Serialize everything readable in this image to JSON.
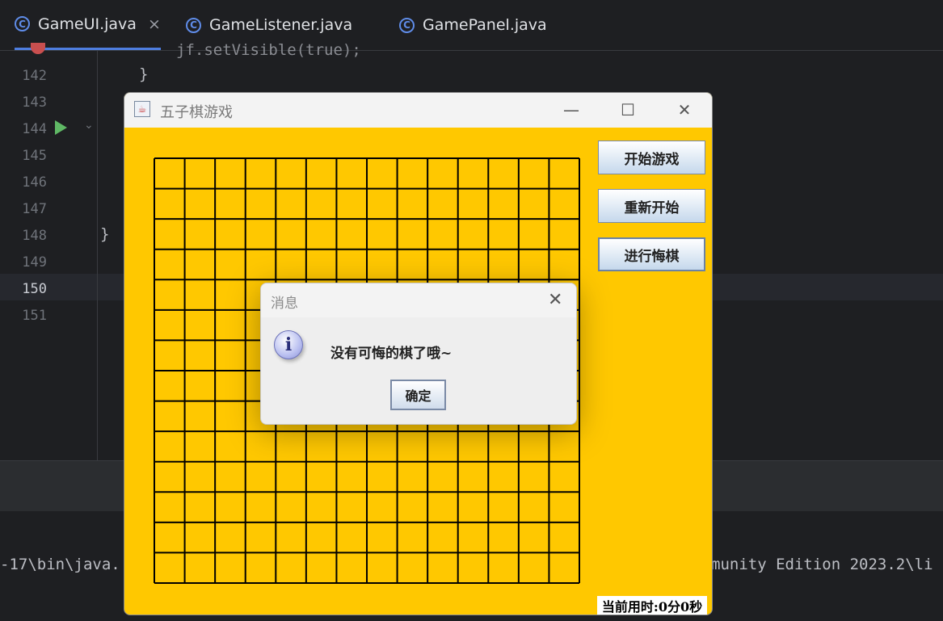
{
  "ide": {
    "tabs": [
      {
        "label": "GameUI.java",
        "icon": "class-icon",
        "active": true
      },
      {
        "label": "GameListener.java",
        "icon": "class-icon"
      },
      {
        "label": "GamePanel.java",
        "icon": "class-icon"
      }
    ],
    "tab_close": "×",
    "line_numbers": [
      "142",
      "143",
      "144",
      "145",
      "146",
      "147",
      "148",
      "149",
      "150",
      "151"
    ],
    "code_fragment_top": "jf.setVisible(true);",
    "code_brace_1": "}",
    "code_brace_2": "}",
    "console_left": "-17\\bin\\java.",
    "console_right": "munity Edition 2023.2\\li"
  },
  "game_window": {
    "title": "五子棋游戏",
    "java_glyph": "☕",
    "minimize": "—",
    "maximize": "☐",
    "close": "✕",
    "board": {
      "rows": 14,
      "cols": 14,
      "line_color": "#000000",
      "bg_color": "#ffc800"
    },
    "buttons": {
      "start": "开始游戏",
      "restart": "重新开始",
      "undo": "进行悔棋"
    },
    "timer": "当前用时:0分0秒"
  },
  "dialog": {
    "title": "消息",
    "close": "✕",
    "info_glyph": "i",
    "message": "没有可悔的棋了哦~",
    "ok_label": "确定"
  }
}
